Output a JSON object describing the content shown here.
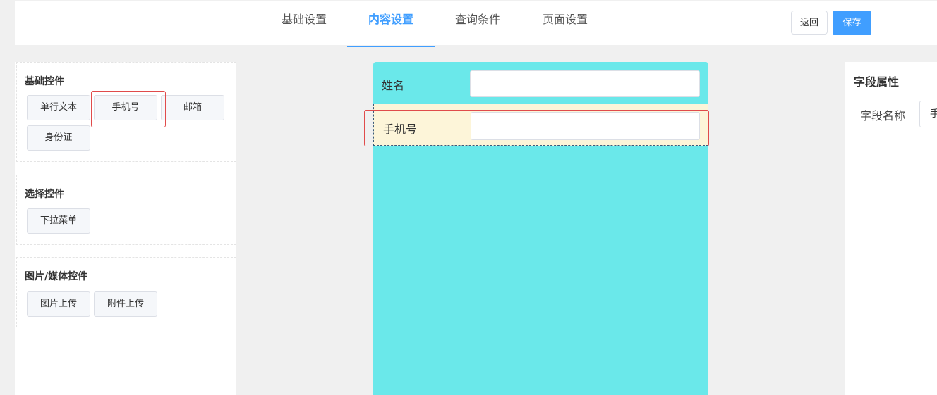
{
  "header": {
    "tabs": [
      {
        "label": "基础设置",
        "active": false
      },
      {
        "label": "内容设置",
        "active": true
      },
      {
        "label": "查询条件",
        "active": false
      },
      {
        "label": "页面设置",
        "active": false
      }
    ],
    "back_label": "返回",
    "save_label": "保存"
  },
  "palette": {
    "groups": [
      {
        "title": "基础控件",
        "items": [
          "单行文本",
          "手机号",
          "邮箱",
          "身份证"
        ]
      },
      {
        "title": "选择控件",
        "items": [
          "下拉菜单"
        ]
      },
      {
        "title": "图片/媒体控件",
        "items": [
          "图片上传",
          "附件上传"
        ]
      }
    ]
  },
  "canvas": {
    "fields": [
      {
        "label": "姓名",
        "value": "",
        "selected": false
      },
      {
        "label": "手机号",
        "value": "",
        "selected": true
      }
    ]
  },
  "properties": {
    "title": "字段属性",
    "field_name_label": "字段名称",
    "field_name_value": "手机号"
  },
  "colors": {
    "accent": "#409eff",
    "canvas_bg": "#6ae8ea",
    "selected_row_bg": "#fdf5d9",
    "highlight": "#e04b4b"
  }
}
